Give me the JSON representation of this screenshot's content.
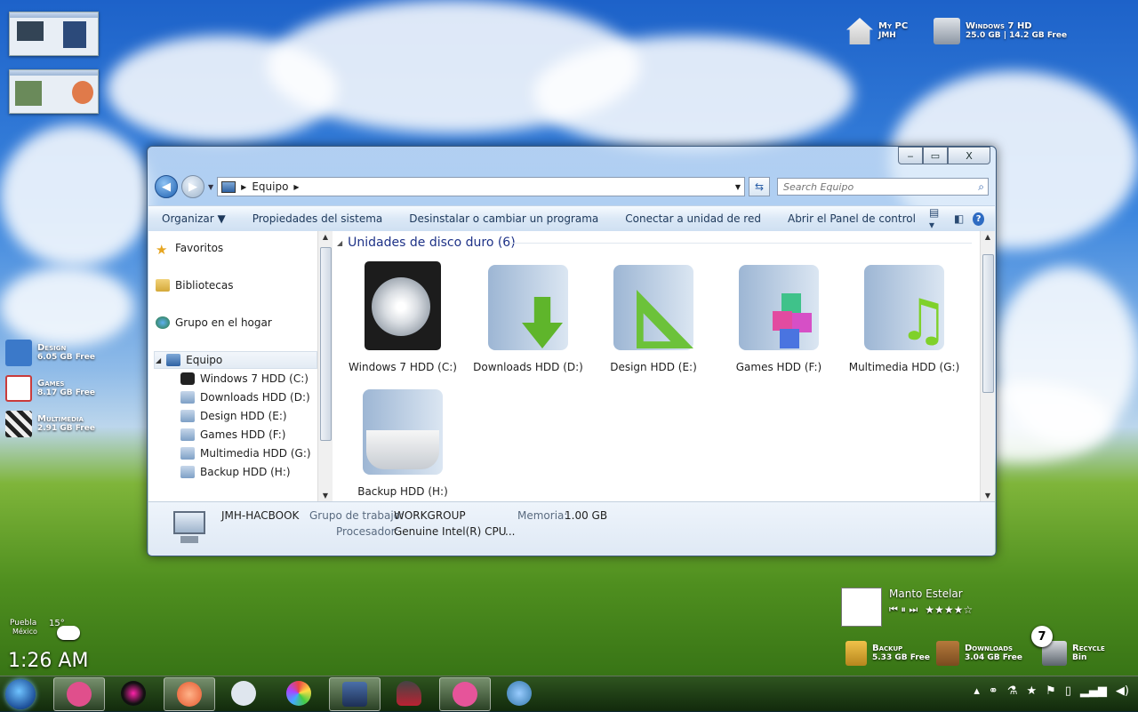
{
  "desktop": {
    "my_pc": {
      "title": "My PC",
      "sub": "JMH"
    },
    "win7hd": {
      "title": "Windows 7 HD",
      "sub": "25.0 GB | 14.2 GB Free"
    },
    "left_drives": [
      {
        "title": "Design",
        "sub": "6.05 GB Free",
        "color": "#3b79c9"
      },
      {
        "title": "Games",
        "sub": "8.17 GB Free",
        "color": "#c93b3b"
      },
      {
        "title": "Multimedia",
        "sub": "2.91 GB Free",
        "color": "#222222"
      }
    ],
    "bottom_drives": [
      {
        "title": "Backup",
        "sub": "5.33 GB Free"
      },
      {
        "title": "Downloads",
        "sub": "3.04 GB Free"
      },
      {
        "title": "Recycle",
        "sub": "Bin"
      }
    ],
    "recycle_count": "7",
    "weather": {
      "city": "Puebla",
      "region": "México",
      "temp": "15°"
    },
    "clock": "1:26 AM",
    "player": {
      "song": "Manto Estelar",
      "controls": "⏮ ⏸ ⏭",
      "rating": "★★★★☆"
    }
  },
  "window": {
    "controls": {
      "minimize": "‒",
      "maximize": "▭",
      "close": "X"
    },
    "address": {
      "crumb": "Equipo"
    },
    "search": {
      "placeholder": "Search Equipo"
    },
    "toolbar": [
      "Organizar ▼",
      "Propiedades del sistema",
      "Desinstalar o cambiar un programa",
      "Conectar a unidad de red",
      "Abrir el Panel de control"
    ],
    "nav": {
      "favorites": "Favoritos",
      "libraries": "Bibliotecas",
      "homegroup": "Grupo en el hogar",
      "computer": "Equipo",
      "drives": [
        "Windows 7 HDD (C:)",
        "Downloads HDD (D:)",
        "Design HDD (E:)",
        "Games HDD (F:)",
        "Multimedia HDD (G:)",
        "Backup HDD (H:)"
      ]
    },
    "group_title": "Unidades de disco duro (6)",
    "drives": [
      {
        "label": "Windows 7 HDD (C:)"
      },
      {
        "label": "Downloads HDD (D:)"
      },
      {
        "label": "Design HDD (E:)"
      },
      {
        "label": "Games HDD (F:)"
      },
      {
        "label": "Multimedia HDD (G:)"
      },
      {
        "label": "Backup HDD (H:)"
      }
    ],
    "details": {
      "name": "JMH-HACBOOK",
      "workgroup_key": "Grupo de trabajo:",
      "workgroup_val": "WORKGROUP",
      "memory_key": "Memoria:",
      "memory_val": "1.00 GB",
      "cpu_key": "Procesador:",
      "cpu_val": "Genuine Intel(R) CPU",
      "more": "..."
    }
  },
  "colors": {
    "accent": "#1e3287",
    "folder": "#b9cde4"
  }
}
